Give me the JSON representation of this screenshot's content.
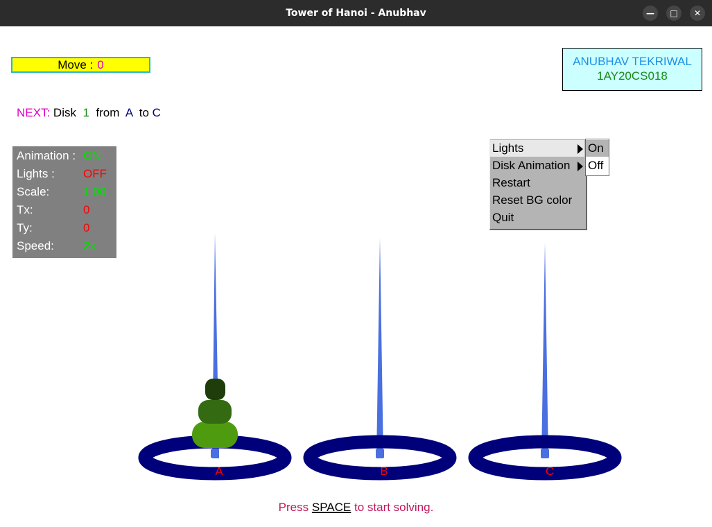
{
  "window": {
    "title": "Tower of Hanoi - Anubhav"
  },
  "move": {
    "label": "Move :",
    "value": "0"
  },
  "author": {
    "name": "ANUBHAV TEKRIWAL",
    "id": "1AY20CS018"
  },
  "next": {
    "label": "NEXT:",
    "disk_word": "Disk",
    "disk_number": "1",
    "from_word": "from",
    "from_peg": "A",
    "to_word": "to",
    "to_peg": "C"
  },
  "stats": [
    {
      "key": "Animation :",
      "value": "ON",
      "color": "#00e000"
    },
    {
      "key": "Lights :",
      "value": "OFF",
      "color": "#ff0000"
    },
    {
      "key": "Scale:",
      "value": "1.00",
      "color": "#00e000"
    },
    {
      "key": "Tx:",
      "value": "0",
      "color": "#ff0000"
    },
    {
      "key": "Ty:",
      "value": "0",
      "color": "#ff0000"
    },
    {
      "key": "Speed:",
      "value": "2x",
      "color": "#00e000"
    }
  ],
  "menu": {
    "items": [
      "Lights",
      "Disk Animation",
      "Restart",
      "Reset BG color",
      "Quit"
    ],
    "submenu": [
      "On",
      "Off"
    ]
  },
  "pegs": {
    "labels": [
      "A",
      "B",
      "C"
    ],
    "disks_on_peg_A": 3,
    "colors": {
      "base": "#00007a",
      "rod": "#4a6fe0",
      "disk1": "#1f3d0a",
      "disk2": "#346b12",
      "disk3": "#4f9b10"
    }
  },
  "hint": {
    "before": "Press",
    "key": "SPACE",
    "after": "to start solving."
  }
}
